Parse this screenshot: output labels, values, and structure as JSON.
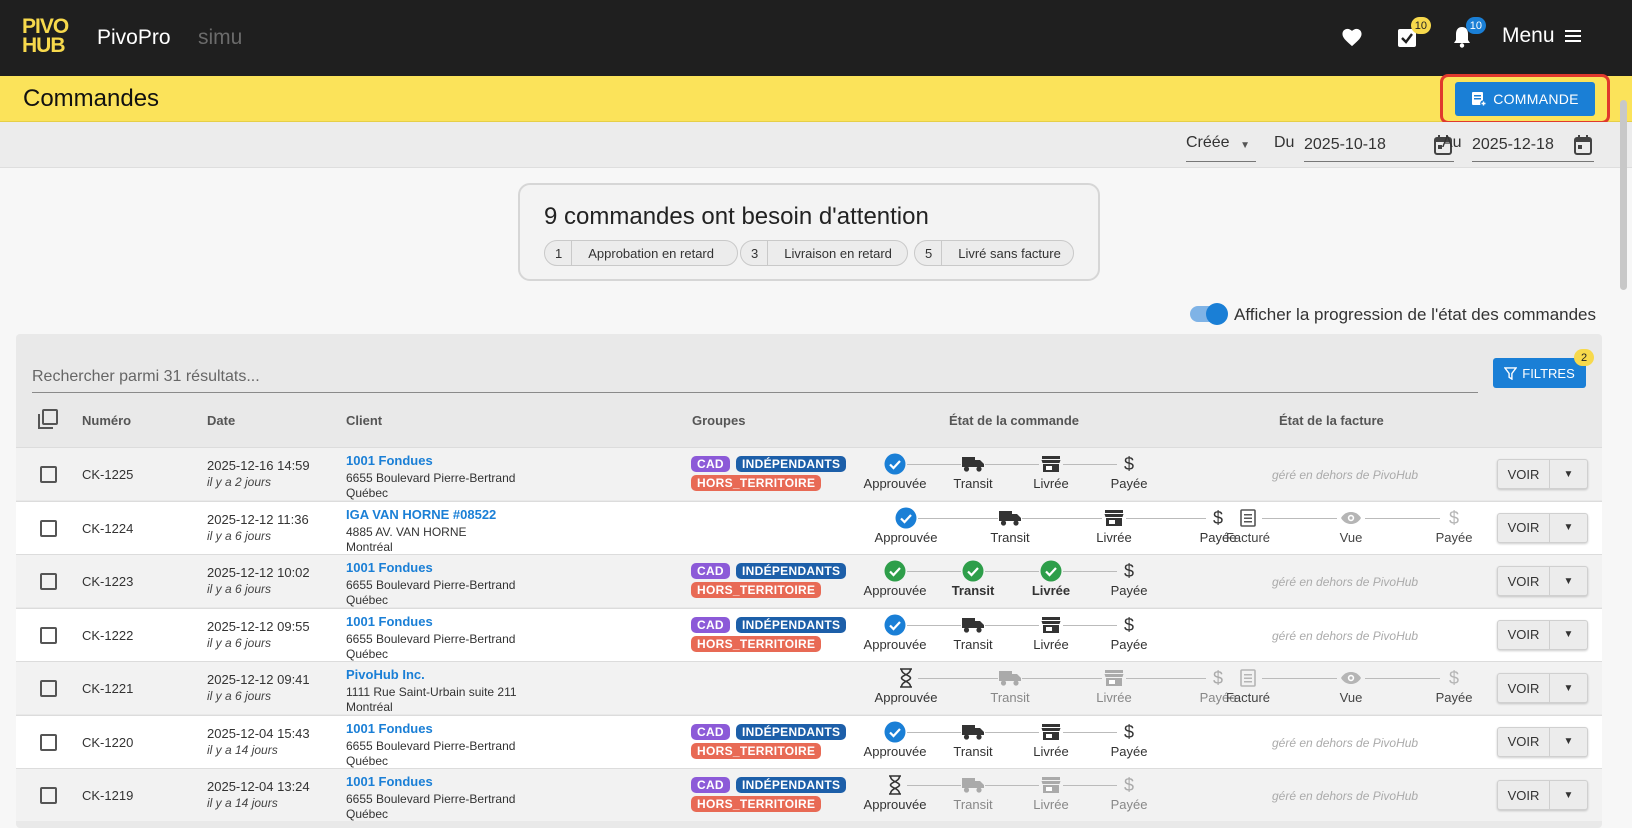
{
  "header": {
    "logo_text": "PIVO HUB",
    "app_name": "PivoPro",
    "env_name": "simu",
    "tasks_count": "10",
    "notifications_count": "10",
    "menu_label": "Menu",
    "icons": [
      "heart-icon",
      "tasks-icon",
      "bell-icon",
      "hamburger-icon"
    ]
  },
  "page": {
    "title": "Commandes",
    "new_order_label": "COMMANDE"
  },
  "date_filter": {
    "mode": "Créée",
    "from_label": "Du",
    "from_value": "2025-10-18",
    "to_label": "Au",
    "to_value": "2025-12-18"
  },
  "attention": {
    "title": "9 commandes ont besoin d'attention",
    "chips": [
      {
        "count": "1",
        "label": "Approbation en retard"
      },
      {
        "count": "3",
        "label": "Livraison en retard"
      },
      {
        "count": "5",
        "label": "Livré sans facture"
      }
    ]
  },
  "toggle": {
    "label": "Afficher la progression de l'état des commandes",
    "on": true
  },
  "search": {
    "placeholder": "Rechercher parmi 31 résultats..."
  },
  "filters": {
    "label": "FILTRES",
    "count": "2"
  },
  "table": {
    "headers": [
      "Numéro",
      "Date",
      "Client",
      "Groupes",
      "État de la commande",
      "État de la facture"
    ],
    "order_steps": [
      "Approuvée",
      "Transit",
      "Livrée",
      "Payée"
    ],
    "invoice_steps": [
      "Facturé",
      "Vue",
      "Payée"
    ],
    "outside_note": "géré en dehors de PivoHub",
    "view_label": "VOIR",
    "rows": [
      {
        "num": "CK-1225",
        "date": "2025-12-16 14:59",
        "rel": "il y a 2 jours",
        "client": "1001 Fondues",
        "addr1": "6655 Boulevard Pierre-Bertrand",
        "addr2": "Québec",
        "groups": [
          "CAD",
          "INDÉPENDANTS",
          "HORS_TERRITOIRE"
        ],
        "order_progress": 1,
        "invoice": "outside"
      },
      {
        "num": "CK-1224",
        "date": "2025-12-12 11:36",
        "rel": "il y a 6 jours",
        "client": "IGA VAN HORNE #08522",
        "addr1": "4885 AV. VAN HORNE",
        "addr2": "Montréal",
        "groups": [],
        "order_progress": 1,
        "invoice": "steps"
      },
      {
        "num": "CK-1223",
        "date": "2025-12-12 10:02",
        "rel": "il y a 6 jours",
        "client": "1001 Fondues",
        "addr1": "6655 Boulevard Pierre-Bertrand",
        "addr2": "Québec",
        "groups": [
          "CAD",
          "INDÉPENDANTS",
          "HORS_TERRITOIRE"
        ],
        "order_progress": 3,
        "invoice": "outside"
      },
      {
        "num": "CK-1222",
        "date": "2025-12-12 09:55",
        "rel": "il y a 6 jours",
        "client": "1001 Fondues",
        "addr1": "6655 Boulevard Pierre-Bertrand",
        "addr2": "Québec",
        "groups": [
          "CAD",
          "INDÉPENDANTS",
          "HORS_TERRITOIRE"
        ],
        "order_progress": 1,
        "invoice": "outside"
      },
      {
        "num": "CK-1221",
        "date": "2025-12-12 09:41",
        "rel": "il y a 6 jours",
        "client": "PivoHub Inc.",
        "addr1": "1111 Rue Saint-Urbain suite 211",
        "addr2": "Montréal",
        "groups": [],
        "order_progress": 0,
        "invoice": "steps"
      },
      {
        "num": "CK-1220",
        "date": "2025-12-04 15:43",
        "rel": "il y a 14 jours",
        "client": "1001 Fondues",
        "addr1": "6655 Boulevard Pierre-Bertrand",
        "addr2": "Québec",
        "groups": [
          "CAD",
          "INDÉPENDANTS",
          "HORS_TERRITOIRE"
        ],
        "order_progress": 1,
        "invoice": "outside"
      },
      {
        "num": "CK-1219",
        "date": "2025-12-04 13:24",
        "rel": "il y a 14 jours",
        "client": "1001 Fondues",
        "addr1": "6655 Boulevard Pierre-Bertrand",
        "addr2": "Québec",
        "groups": [
          "CAD",
          "INDÉPENDANTS",
          "HORS_TERRITOIRE"
        ],
        "order_progress": 0,
        "invoice": "outside"
      }
    ]
  },
  "colors": {
    "accent_blue": "#1a7fd6",
    "brand_yellow": "#fbe35a",
    "success_green": "#2e9e4a",
    "tag_cad": "#8c5ad8",
    "tag_ind": "#1d5fa9",
    "tag_hors": "#e86a55"
  }
}
